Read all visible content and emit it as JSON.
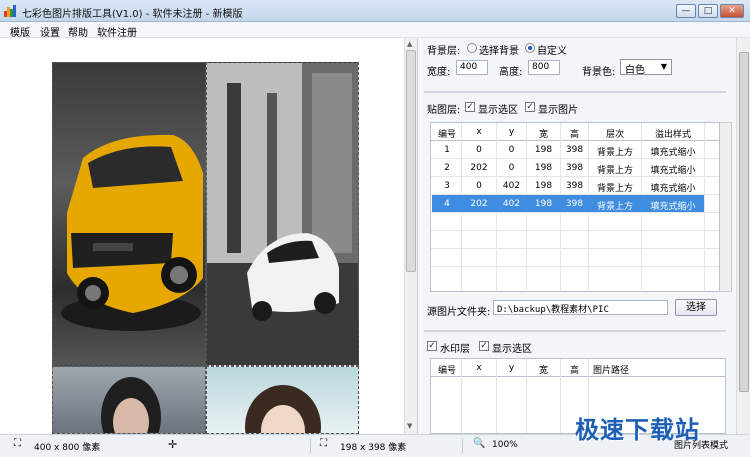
{
  "window": {
    "title": "七彩色图片排版工具(V1.0) - 软件未注册 - 新模版",
    "minimize": "—",
    "maximize": "□",
    "close": "✕"
  },
  "menu": [
    "模版",
    "设置",
    "帮助",
    "软件注册"
  ],
  "background": {
    "label": "背景层:",
    "option_select": "选择背景",
    "option_custom": "自定义",
    "selected": "自定义",
    "width_label": "宽度:",
    "width_value": "400",
    "height_label": "高度:",
    "height_value": "800",
    "color_label": "背景色:",
    "color_value": "白色"
  },
  "paste_layer": {
    "label": "贴图层:",
    "show_selection": "显示选区",
    "show_selection_checked": true,
    "show_image": "显示图片",
    "show_image_checked": true,
    "columns": [
      "编号",
      "x",
      "y",
      "宽",
      "高",
      "层次",
      "溢出样式"
    ],
    "rows": [
      [
        "1",
        "0",
        "0",
        "198",
        "398",
        "背景上方",
        "填充式缩小"
      ],
      [
        "2",
        "202",
        "0",
        "198",
        "398",
        "背景上方",
        "填充式缩小"
      ],
      [
        "3",
        "0",
        "402",
        "198",
        "398",
        "背景上方",
        "填充式缩小"
      ],
      [
        "4",
        "202",
        "402",
        "198",
        "398",
        "背景上方",
        "填充式缩小"
      ]
    ],
    "selected_row": 3,
    "source_label": "源图片文件夹:",
    "source_value": "D:\\backup\\教程素材\\PIC",
    "select_button": "选择"
  },
  "watermark_layer": {
    "label": "水印层",
    "checked": true,
    "show_selection": "显示选区",
    "show_selection_checked": true,
    "columns": [
      "编号",
      "x",
      "y",
      "宽",
      "高",
      "图片路径"
    ]
  },
  "status": {
    "canvas_size": "400 x 800 像素",
    "selection_size": "198 x 398 像素",
    "zoom": "100%",
    "mode": "图片列表模式"
  },
  "site_watermark": "极速下载站",
  "colors": {
    "selection": "#3e8de0",
    "watermark": "#1d5fb5"
  }
}
